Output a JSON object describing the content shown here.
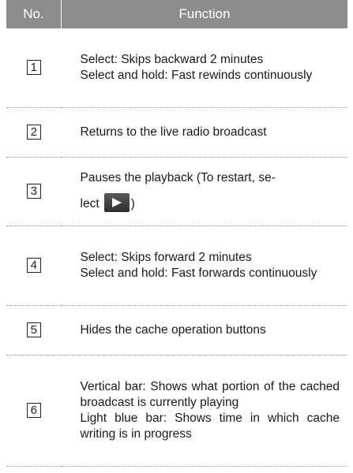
{
  "header": {
    "no": "No.",
    "function": "Function"
  },
  "rows": [
    {
      "number": "1",
      "lines": [
        "Select: Skips backward 2 minutes",
        "Select and hold: Fast rewinds continuously"
      ]
    },
    {
      "number": "2",
      "lines": [
        "Returns to the live radio broadcast"
      ]
    },
    {
      "number": "3",
      "text_before": "Pauses the playback (To restart, se-",
      "text_select": "lect",
      "text_after": ")",
      "icon": "play-icon"
    },
    {
      "number": "4",
      "lines": [
        "Select: Skips forward 2 minutes",
        "Select and hold: Fast forwards continuously"
      ]
    },
    {
      "number": "5",
      "lines": [
        "Hides the cache operation buttons"
      ]
    },
    {
      "number": "6",
      "lines": [
        "Vertical bar: Shows what portion of the cached broadcast is currently playing",
        "Light blue bar: Shows time in which cache writing is in progress"
      ]
    }
  ],
  "colors": {
    "header_bg": "#8c8c8c",
    "header_text": "#ffffff",
    "divider": "#9a9a9a"
  }
}
